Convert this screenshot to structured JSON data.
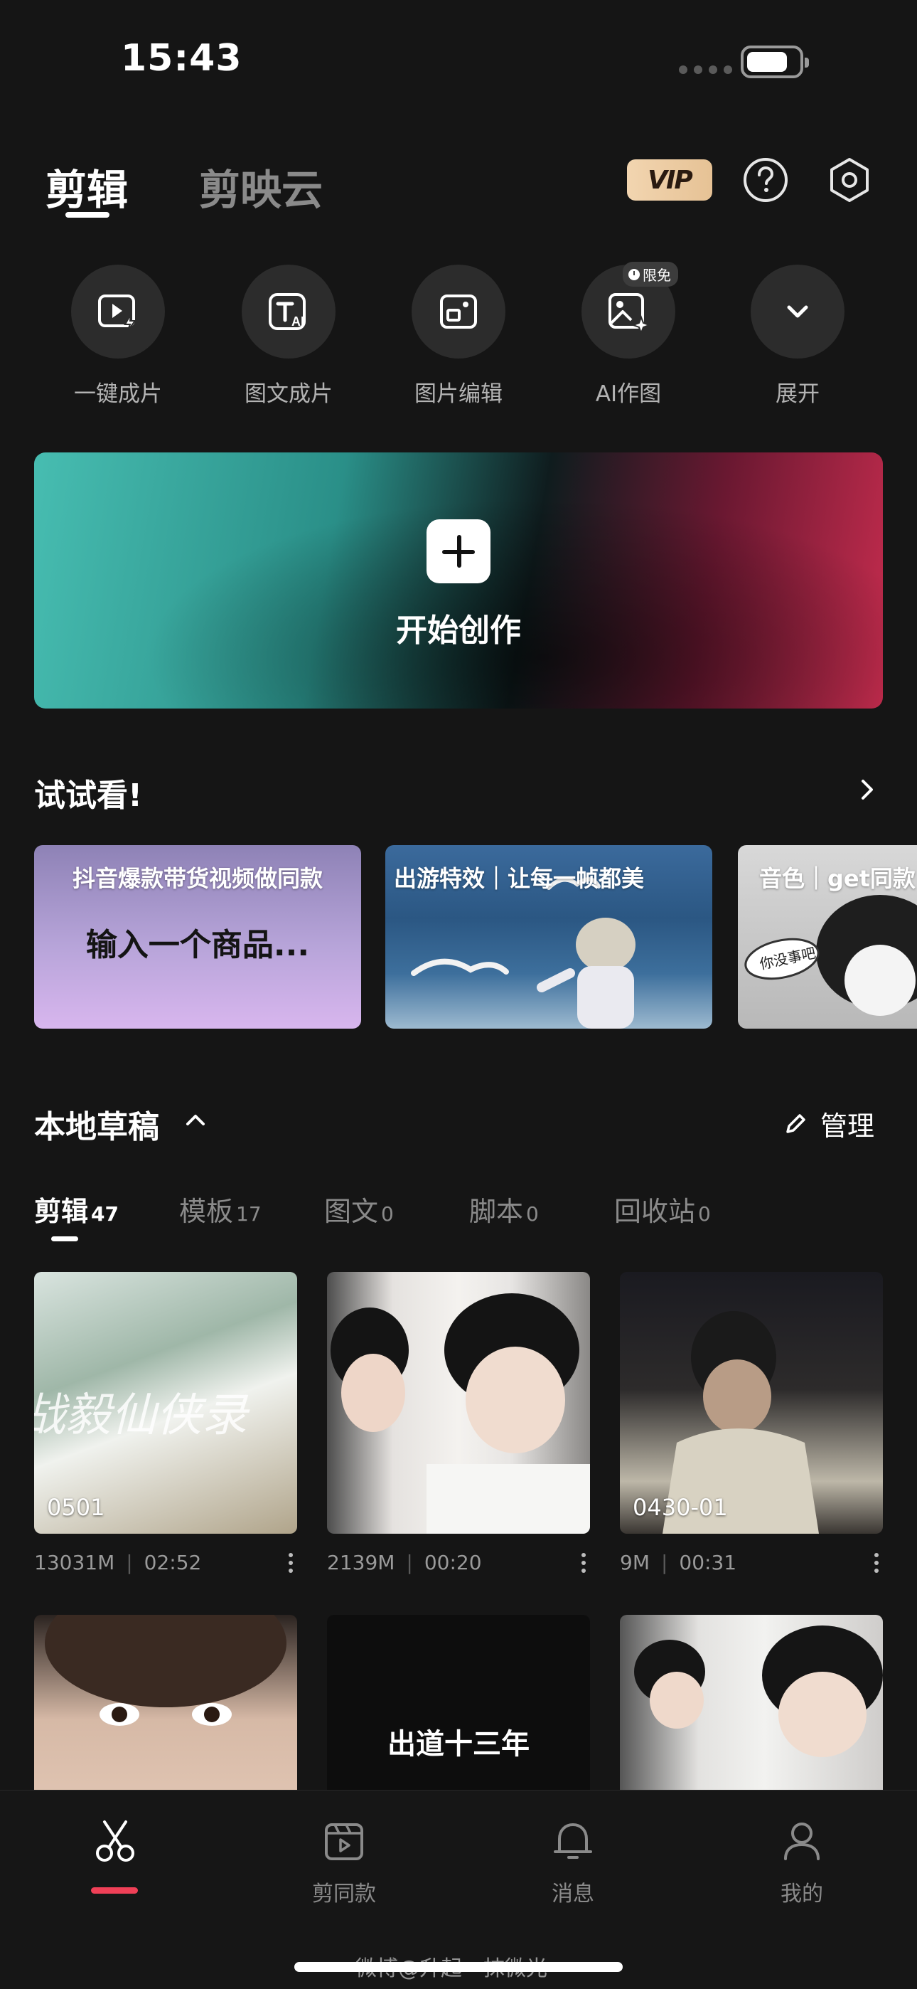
{
  "status": {
    "time": "15:43"
  },
  "header": {
    "tab_active": "剪辑",
    "tab_cloud": "剪映云",
    "vip": "VIP"
  },
  "tools": [
    {
      "label": "一键成片",
      "icon": "play-flash-icon"
    },
    {
      "label": "图文成片",
      "icon": "text-ai-icon"
    },
    {
      "label": "图片编辑",
      "icon": "image-edit-icon"
    },
    {
      "label": "AI作图",
      "icon": "ai-image-icon",
      "badge": "限免"
    },
    {
      "label": "展开",
      "icon": "chevron-down-icon"
    }
  ],
  "create": {
    "label": "开始创作"
  },
  "try": {
    "title": "试试看!",
    "cards": [
      {
        "title": "抖音爆款带货视频做同款",
        "subtitle": "输入一个商品..."
      },
      {
        "title": "出游特效｜让每一帧都美"
      },
      {
        "title": "音色｜get同款",
        "bubble": "你没事吧"
      }
    ]
  },
  "drafts": {
    "title": "本地草稿",
    "manage": "管理",
    "tabs": [
      {
        "label": "剪辑",
        "count": "47"
      },
      {
        "label": "模板",
        "count": "17"
      },
      {
        "label": "图文",
        "count": "0"
      },
      {
        "label": "脚本",
        "count": "0"
      },
      {
        "label": "回收站",
        "count": "0"
      }
    ],
    "items": [
      {
        "name": "0501",
        "size": "13031M",
        "duration": "02:52"
      },
      {
        "name": "",
        "size": "2139M",
        "duration": "00:20"
      },
      {
        "name": "0430-01",
        "size": "9M",
        "duration": "00:31"
      },
      {
        "name": ""
      },
      {
        "name": "",
        "overlay": "出道十三年"
      },
      {
        "name": ""
      }
    ],
    "thumb1_text": "战毅仙侠录"
  },
  "nav": [
    {
      "label": "",
      "icon": "scissors-icon"
    },
    {
      "label": "剪同款",
      "icon": "clapper-icon"
    },
    {
      "label": "消息",
      "icon": "bell-icon"
    },
    {
      "label": "我的",
      "icon": "person-icon"
    }
  ],
  "watermark": "微博@升起一抹微光",
  "colors": {
    "accent": "#f04057",
    "vip_gold": "#ecc99f",
    "background": "#151515"
  }
}
